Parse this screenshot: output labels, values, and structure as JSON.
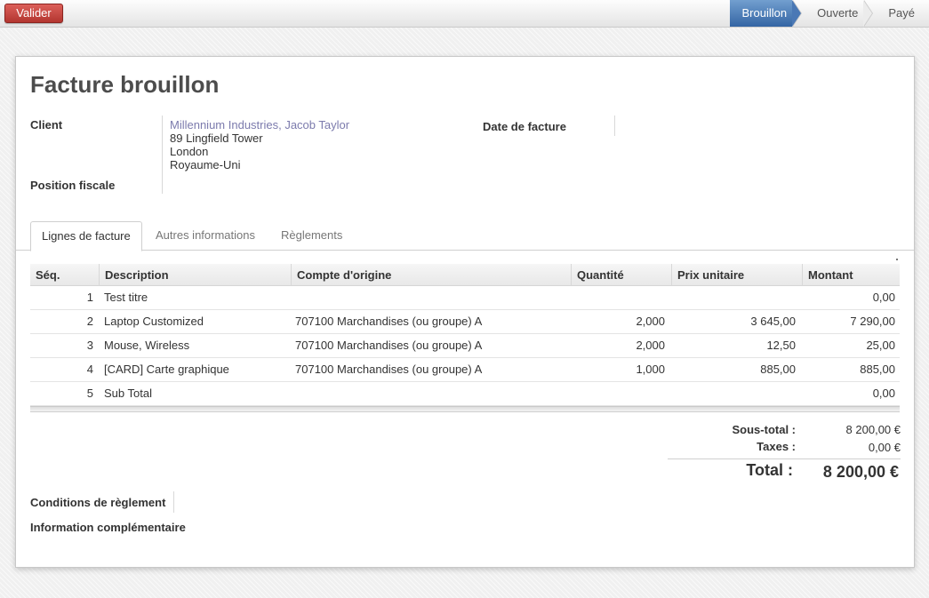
{
  "statusbar": {
    "validate_label": "Valider",
    "stages": [
      {
        "label": "Brouillon",
        "active": true
      },
      {
        "label": "Ouverte",
        "active": false
      },
      {
        "label": "Payé",
        "active": false
      }
    ]
  },
  "invoice": {
    "title": "Facture brouillon",
    "client_label": "Client",
    "client_name": "Millennium Industries, Jacob Taylor",
    "client_address": [
      "89 Lingfield Tower",
      "London",
      "Royaume-Uni"
    ],
    "fiscal_position_label": "Position fiscale",
    "invoice_date_label": "Date de facture",
    "invoice_date_value": ""
  },
  "tabs": [
    "Lignes de facture",
    "Autres informations",
    "Règlements"
  ],
  "lines": {
    "columns": [
      "Séq.",
      "Description",
      "Compte d'origine",
      "Quantité",
      "Prix unitaire",
      "Montant"
    ],
    "rows": [
      {
        "seq": "1",
        "description": "Test titre",
        "account": "",
        "quantity": "",
        "unit_price": "",
        "amount": "0,00"
      },
      {
        "seq": "2",
        "description": "Laptop Customized",
        "account": "707100 Marchandises (ou groupe) A",
        "quantity": "2,000",
        "unit_price": "3 645,00",
        "amount": "7 290,00"
      },
      {
        "seq": "3",
        "description": "Mouse, Wireless",
        "account": "707100 Marchandises (ou groupe) A",
        "quantity": "2,000",
        "unit_price": "12,50",
        "amount": "25,00"
      },
      {
        "seq": "4",
        "description": "[CARD] Carte graphique",
        "account": "707100 Marchandises (ou groupe) A",
        "quantity": "1,000",
        "unit_price": "885,00",
        "amount": "885,00"
      },
      {
        "seq": "5",
        "description": "Sub Total",
        "account": "",
        "quantity": "",
        "unit_price": "",
        "amount": "0,00"
      }
    ]
  },
  "totals": {
    "subtotal_label": "Sous-total :",
    "subtotal_value": "8 200,00 €",
    "taxes_label": "Taxes :",
    "taxes_value": "0,00 €",
    "total_label": "Total :",
    "total_value": "8 200,00 €"
  },
  "footer": {
    "payment_terms_label": "Conditions de règlement",
    "additional_info_label": "Information complémentaire"
  },
  "colors": {
    "accent_blue": "#3465a4",
    "validate_red": "#c9413b",
    "link": "#7c7bad"
  }
}
